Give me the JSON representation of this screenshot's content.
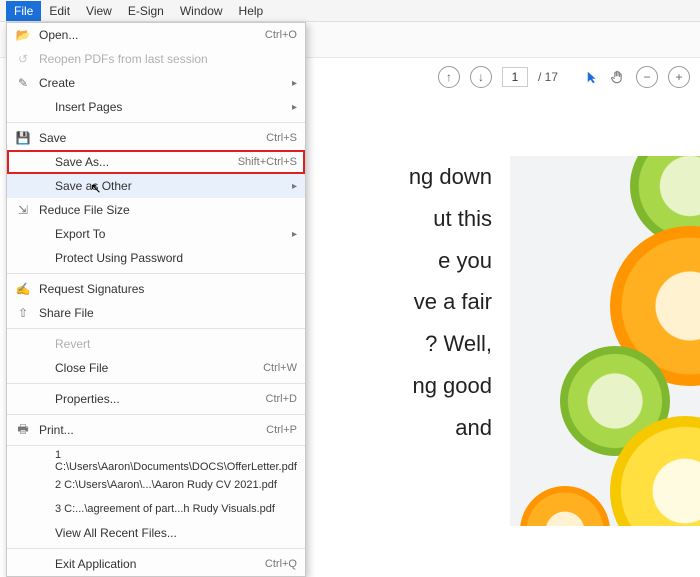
{
  "menubar": {
    "items": [
      "File",
      "Edit",
      "View",
      "E-Sign",
      "Window",
      "Help"
    ]
  },
  "pagenav": {
    "current": "1",
    "total": "/ 17"
  },
  "menu": {
    "open": "Open...",
    "open_sc": "Ctrl+O",
    "reopen": "Reopen PDFs from last session",
    "create": "Create",
    "insert_pages": "Insert Pages",
    "save": "Save",
    "save_sc": "Ctrl+S",
    "save_as": "Save As...",
    "save_as_sc": "Shift+Ctrl+S",
    "save_other": "Save as Other",
    "reduce": "Reduce File Size",
    "export": "Export To",
    "protect": "Protect Using Password",
    "req_sig": "Request Signatures",
    "share": "Share File",
    "revert": "Revert",
    "close": "Close File",
    "close_sc": "Ctrl+W",
    "properties": "Properties...",
    "properties_sc": "Ctrl+D",
    "print": "Print...",
    "print_sc": "Ctrl+P",
    "recent1": "1 C:\\Users\\Aaron\\Documents\\DOCS\\OfferLetter.pdf",
    "recent2": "2 C:\\Users\\Aaron\\...\\Aaron Rudy CV 2021.pdf",
    "recent3": "3 C:...\\agreement of part...h Rudy Visuals.pdf",
    "view_recent": "View All Recent Files...",
    "exit": "Exit Application",
    "exit_sc": "Ctrl+Q"
  },
  "document": {
    "text": "ng down\nut this\ne you\nve a fair\n? Well,\nng good\nand"
  }
}
